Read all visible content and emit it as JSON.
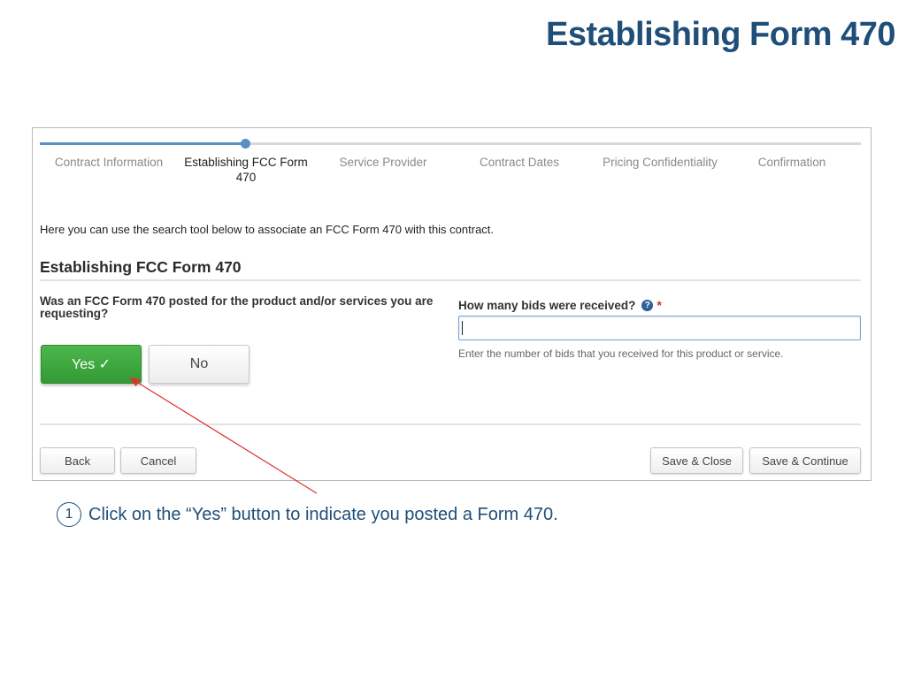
{
  "slide": {
    "title": "Establishing Form 470",
    "instruction_number": "1",
    "instruction_text": "Click on the “Yes” button to indicate you posted a Form 470."
  },
  "stepper": {
    "progress": 0.25,
    "steps": [
      {
        "label": "Contract Information",
        "state": "completed"
      },
      {
        "label": "Establishing FCC Form 470",
        "state": "active"
      },
      {
        "label": "Service Provider",
        "state": "pending"
      },
      {
        "label": "Contract Dates",
        "state": "pending"
      },
      {
        "label": "Pricing Confidentiality",
        "state": "pending"
      },
      {
        "label": "Confirmation",
        "state": "pending"
      }
    ]
  },
  "form": {
    "intro": "Here you can use the search tool below to associate an FCC Form 470 with this contract.",
    "heading": "Establishing FCC Form 470",
    "question": "Was an FCC Form 470 posted for the product and/or services you are requesting?",
    "yes_label": "Yes ✓",
    "no_label": "No",
    "bids_label": "How many bids were received?",
    "help_icon": "?",
    "required_mark": "*",
    "bids_value": "",
    "bids_hint": "Enter the number of bids that you received for this product or service."
  },
  "footer": {
    "back_label": "Back",
    "cancel_label": "Cancel",
    "save_close_label": "Save & Close",
    "save_continue_label": "Save & Continue"
  },
  "colors": {
    "title": "#1f4e79",
    "yes_button": "#3ca83c",
    "progress": "#5b8ec4",
    "arrow": "#e03030"
  }
}
